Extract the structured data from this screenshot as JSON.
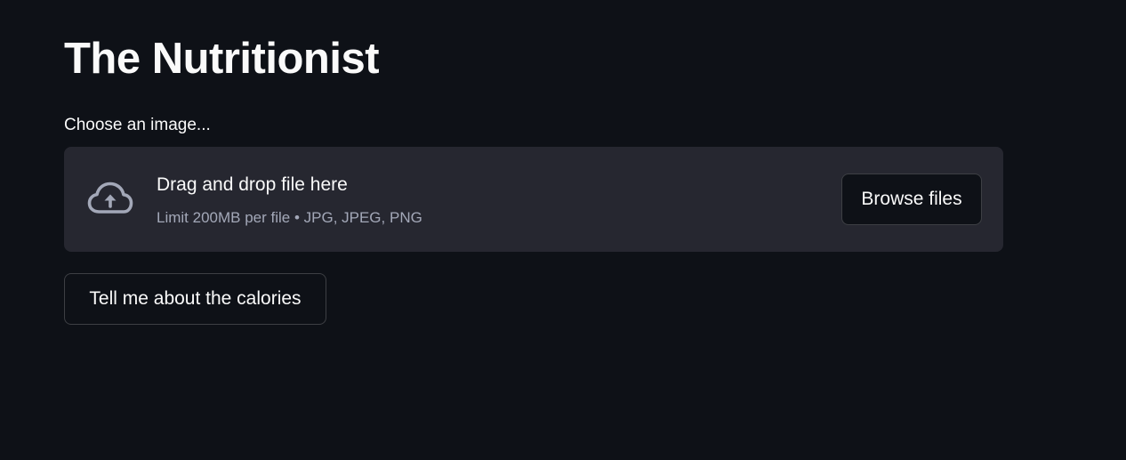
{
  "page": {
    "title": "The Nutritionist"
  },
  "uploader": {
    "label": "Choose an image...",
    "drop_text": "Drag and drop file here",
    "limit_text": "Limit 200MB per file • JPG, JPEG, PNG",
    "browse_label": "Browse files",
    "icon": "cloud-upload-icon"
  },
  "actions": {
    "calories_label": "Tell me about the calories"
  },
  "colors": {
    "background": "#0e1117",
    "dropzone": "#262730",
    "text": "#fafafa",
    "muted_text": "#a3a8b8"
  }
}
